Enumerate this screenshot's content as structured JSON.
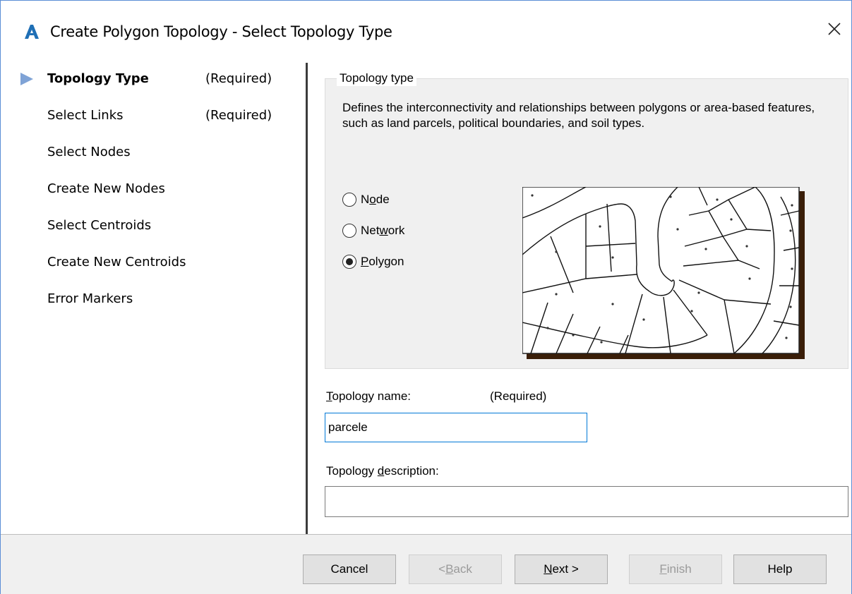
{
  "window": {
    "title": "Create Polygon Topology - Select Topology Type",
    "accent_color": "#5b8ed6"
  },
  "icons": {
    "app": "autocad-a-icon",
    "close": "close-icon",
    "nav_marker": "triangle-right-icon"
  },
  "nav": {
    "items": [
      {
        "label": "Topology Type",
        "required": "(Required)",
        "active": true
      },
      {
        "label": "Select Links",
        "required": "(Required)",
        "active": false
      },
      {
        "label": "Select Nodes",
        "required": "",
        "active": false
      },
      {
        "label": "Create New Nodes",
        "required": "",
        "active": false
      },
      {
        "label": "Select Centroids",
        "required": "",
        "active": false
      },
      {
        "label": "Create New Centroids",
        "required": "",
        "active": false
      },
      {
        "label": "Error Markers",
        "required": "",
        "active": false
      }
    ]
  },
  "topology_type": {
    "legend": "Topology type",
    "description": "Defines the interconnectivity and relationships between polygons or area-based features, such as land parcels, political boundaries, and soil types.",
    "options": [
      {
        "label_before": "N",
        "label_underline": "o",
        "label_after": "de",
        "selected": false
      },
      {
        "label_before": "Net",
        "label_underline": "w",
        "label_after": "ork",
        "selected": false
      },
      {
        "label_before": "",
        "label_underline": "P",
        "label_after": "olygon",
        "selected": true
      }
    ]
  },
  "form": {
    "name_label_underline": "T",
    "name_label_rest": "opology name:",
    "name_required": "(Required)",
    "name_value": "parcele",
    "desc_label_before": "Topology ",
    "desc_label_underline": "d",
    "desc_label_after": "escription:",
    "desc_value": ""
  },
  "buttons": {
    "cancel": "Cancel",
    "back_prefix": "< ",
    "back_underline": "B",
    "back_rest": "ack",
    "next_underline": "N",
    "next_rest": "ext >",
    "finish_underline": "F",
    "finish_rest": "inish",
    "help": "Help"
  }
}
